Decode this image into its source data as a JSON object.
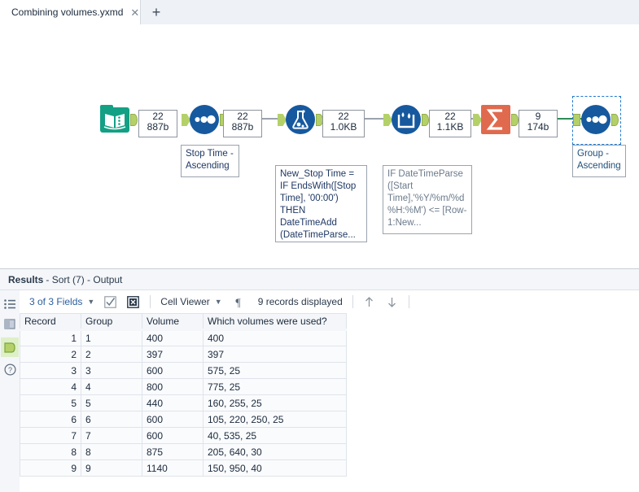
{
  "tab": {
    "title": "Combining volumes.yxmd",
    "close_icon": "close-icon",
    "new_tab_icon": "plus-icon"
  },
  "canvas": {
    "nodes": [
      {
        "id": "input",
        "type": "input-data-tool",
        "icon": "book-icon",
        "annotation": ""
      },
      {
        "id": "sort1",
        "type": "sort-tool",
        "icon": "sort-dots-icon",
        "annotation": "Stop Time - Ascending"
      },
      {
        "id": "formula",
        "type": "formula-tool",
        "icon": "flask-icon",
        "annotation": "New_Stop Time = IF EndsWith([Stop Time], '00:00') THEN DateTimeAdd (DateTimeParse..."
      },
      {
        "id": "multirow",
        "type": "multi-row-formula-tool",
        "icon": "water-droplet-icon",
        "annotation": "IF DateTimeParse ([Start Time],'%Y/%m/%d %H:%M') <= [Row-1:New..."
      },
      {
        "id": "summarize",
        "type": "summarize-tool",
        "icon": "sigma-icon",
        "annotation": ""
      },
      {
        "id": "sort2",
        "type": "sort-tool",
        "icon": "sort-dots-icon",
        "annotation": "Group - Ascending",
        "selected": true
      }
    ],
    "connections": [
      {
        "records": "22",
        "size": "887b"
      },
      {
        "records": "22",
        "size": "887b"
      },
      {
        "records": "22",
        "size": "1.0KB"
      },
      {
        "records": "22",
        "size": "1.1KB"
      },
      {
        "records": "9",
        "size": "174b"
      }
    ]
  },
  "results": {
    "title_label": "Results",
    "title_detail": "- Sort (7) - Output",
    "rail_icons": [
      "list-icon",
      "data-profile-icon",
      "output-anchor-icon",
      "help-icon"
    ],
    "toolbar": {
      "fields_label": "3 of 3 Fields",
      "select_all_icon": "checkbox-icon",
      "deselect_icon": "x-box-icon",
      "viewer_label": "Cell Viewer",
      "pilcrow_icon": "pilcrow-icon",
      "records_label": "9 records displayed",
      "up_icon": "arrow-up-icon",
      "down_icon": "arrow-down-icon"
    },
    "grid": {
      "columns": [
        "Record",
        "Group",
        "Volume",
        "Which volumes were used?"
      ],
      "rows": [
        [
          "1",
          "1",
          "400",
          "400"
        ],
        [
          "2",
          "2",
          "397",
          "397"
        ],
        [
          "3",
          "3",
          "600",
          "575, 25"
        ],
        [
          "4",
          "4",
          "800",
          "775, 25"
        ],
        [
          "5",
          "5",
          "440",
          "160, 255, 25"
        ],
        [
          "6",
          "6",
          "600",
          "105, 220, 250, 25"
        ],
        [
          "7",
          "7",
          "600",
          "40, 535, 25"
        ],
        [
          "8",
          "8",
          "875",
          "205, 640, 30"
        ],
        [
          "9",
          "9",
          "1140",
          "150, 950, 40"
        ]
      ]
    }
  },
  "colors": {
    "input_green": "#13a085",
    "tool_blue": "#17599e",
    "summarize_orange": "#e06a4e",
    "anchor_green": "#b4d169",
    "accent_green": "#8fd14f",
    "selection_blue": "#1f78d1"
  }
}
